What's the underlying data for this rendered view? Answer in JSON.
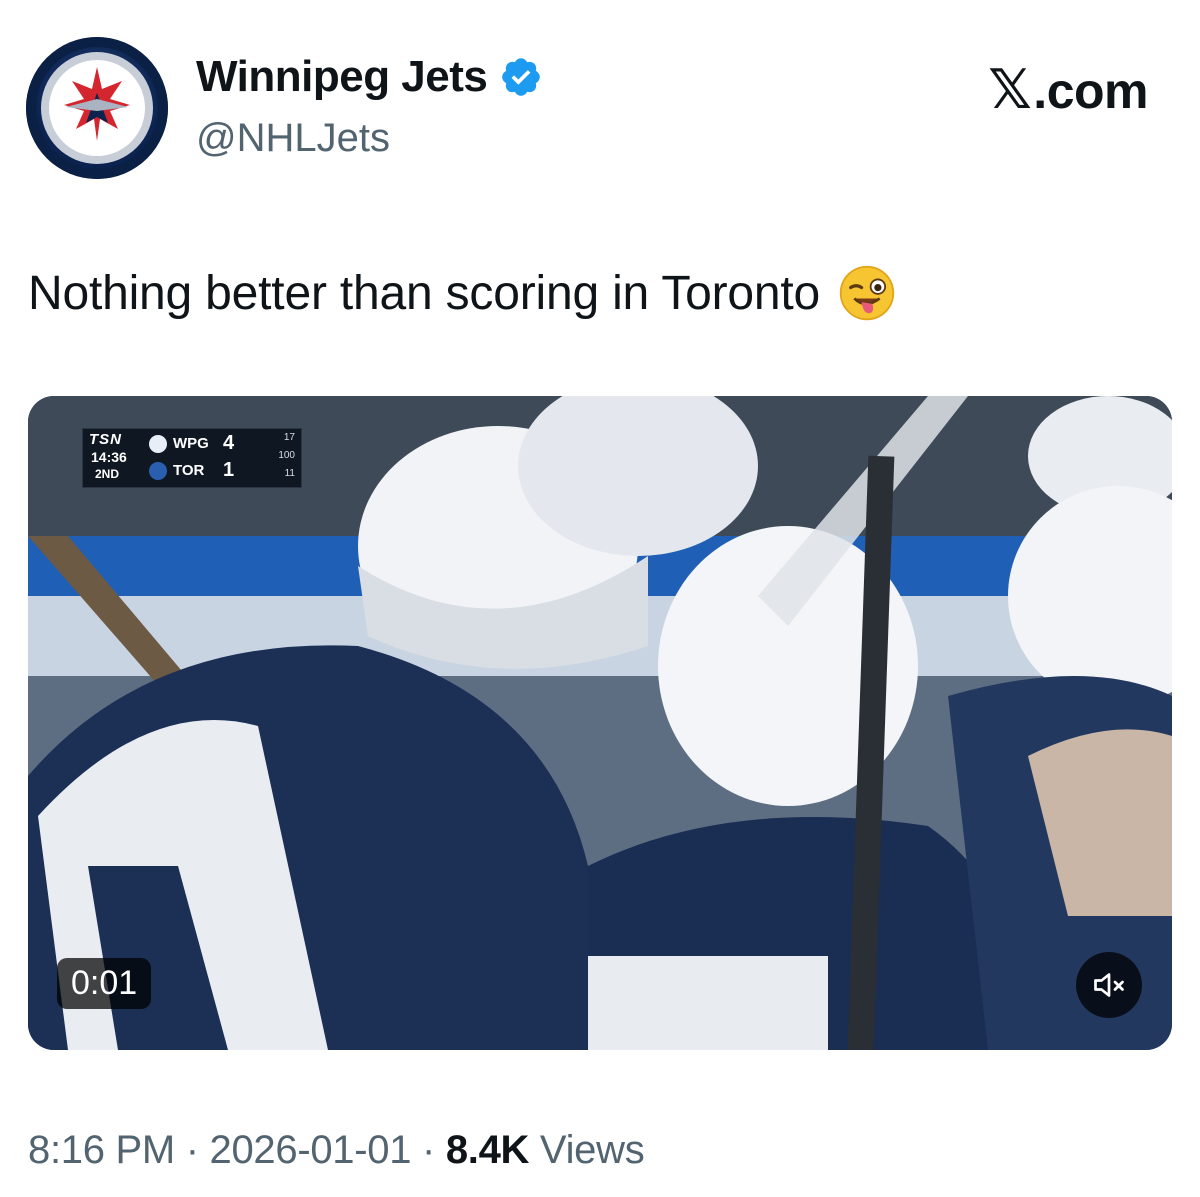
{
  "account": {
    "display_name": "Winnipeg Jets",
    "handle": "@NHLJets",
    "verified": true,
    "avatar_icon": "winnipeg-jets-logo-icon",
    "verified_icon": "verified-badge-icon"
  },
  "brand": {
    "x_logo": "𝕏",
    "domain_suffix": ".com"
  },
  "tweet": {
    "text": "Nothing better than scoring in Toronto",
    "emoji": "winking-face-with-tongue"
  },
  "media": {
    "type": "video",
    "timecode": "0:01",
    "muted": true,
    "mute_icon": "speaker-muted-icon",
    "scorebug": {
      "network": "TSN",
      "clock": "14:36",
      "period": "2ND",
      "home_team": "WPG",
      "home_score": "4",
      "home_stat": "17",
      "away_team": "TOR",
      "away_score": "1",
      "away_stat": "11",
      "middle_stat": "100"
    }
  },
  "footer": {
    "time": "8:16 PM",
    "separator": " · ",
    "date": "2026-01-01",
    "views_count": "8.4K",
    "views_label": " Views"
  },
  "colors": {
    "text": "#0f1419",
    "secondary_text": "#536471",
    "verified_blue": "#1d9bf0",
    "jets_navy": "#041e42"
  }
}
